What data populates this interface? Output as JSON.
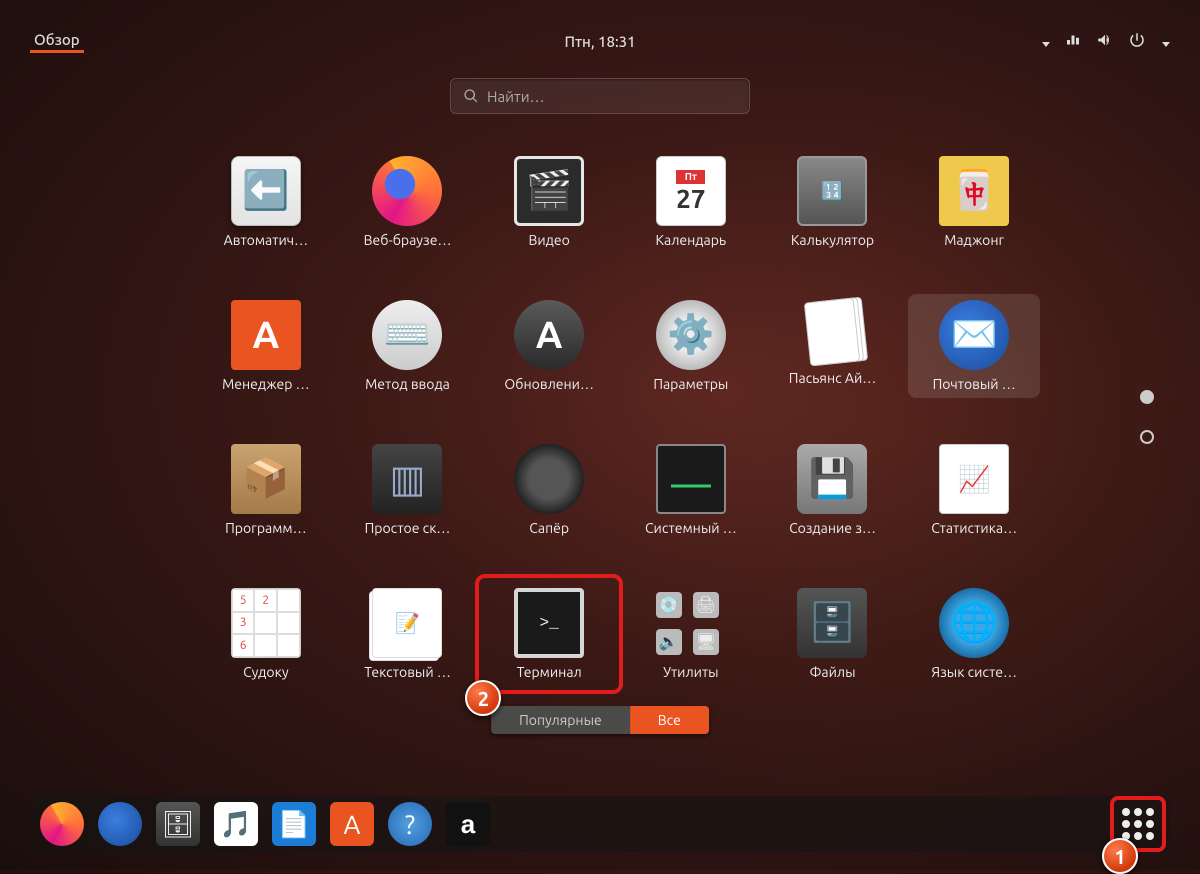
{
  "topbar": {
    "overview": "Обзор",
    "clock": "Птн, 18:31"
  },
  "search": {
    "placeholder": "Найти…"
  },
  "apps": [
    {
      "id": "auto",
      "label": "Автоматич…",
      "icon": "ic-box"
    },
    {
      "id": "firefox",
      "label": "Веб-браузе…",
      "icon": "ic-firefox"
    },
    {
      "id": "video",
      "label": "Видео",
      "icon": "ic-video"
    },
    {
      "id": "calendar",
      "label": "Календарь",
      "icon": "ic-cal"
    },
    {
      "id": "calc",
      "label": "Калькулятор",
      "icon": "ic-calc"
    },
    {
      "id": "mahjong",
      "label": "Маджонг",
      "icon": "ic-mahjong"
    },
    {
      "id": "manager",
      "label": "Менеджер …",
      "icon": "ic-bag"
    },
    {
      "id": "input",
      "label": "Метод ввода",
      "icon": "ic-input"
    },
    {
      "id": "updates",
      "label": "Обновлени…",
      "icon": "ic-update"
    },
    {
      "id": "params",
      "label": "Параметры",
      "icon": "ic-gear"
    },
    {
      "id": "solitaire",
      "label": "Пасьянс Ай…",
      "icon": "ic-cards"
    },
    {
      "id": "mail",
      "label": "Почтовый …",
      "icon": "ic-tbird",
      "selected": true
    },
    {
      "id": "software",
      "label": "Программ…",
      "icon": "ic-pkg"
    },
    {
      "id": "scan",
      "label": "Простое ск…",
      "icon": "ic-scan"
    },
    {
      "id": "mines",
      "label": "Сапёр",
      "icon": "ic-mine"
    },
    {
      "id": "sysmon",
      "label": "Системный …",
      "icon": "ic-mon"
    },
    {
      "id": "backup",
      "label": "Создание з…",
      "icon": "ic-backup"
    },
    {
      "id": "stats",
      "label": "Статистика…",
      "icon": "ic-stats"
    },
    {
      "id": "sudoku",
      "label": "Судоку",
      "icon": "ic-sudoku"
    },
    {
      "id": "text",
      "label": "Текстовый …",
      "icon": "ic-text"
    },
    {
      "id": "terminal",
      "label": "Терминал",
      "icon": "ic-term",
      "highlighted": true
    },
    {
      "id": "util",
      "label": "Утилиты",
      "icon": "ic-util"
    },
    {
      "id": "files",
      "label": "Файлы",
      "icon": "ic-files"
    },
    {
      "id": "lang",
      "label": "Язык систе…",
      "icon": "ic-lang"
    }
  ],
  "calendar_icon": {
    "weekday": "Пт",
    "day": "27"
  },
  "toggle": {
    "frequent": "Популярные",
    "all": "Все",
    "active": "all"
  },
  "dock": [
    {
      "id": "firefox",
      "name": "firefox-icon",
      "cls": "di-firefox"
    },
    {
      "id": "thunderbird",
      "name": "thunderbird-icon",
      "cls": "di-tbird"
    },
    {
      "id": "files",
      "name": "files-icon",
      "cls": "di-files",
      "glyph": "🗄"
    },
    {
      "id": "rhythmbox",
      "name": "rhythmbox-icon",
      "cls": "di-rhythm",
      "glyph": "🎵"
    },
    {
      "id": "writer",
      "name": "writer-icon",
      "cls": "di-writer",
      "glyph": "📄"
    },
    {
      "id": "software",
      "name": "software-icon",
      "cls": "di-soft",
      "glyph": "A"
    },
    {
      "id": "help",
      "name": "help-icon",
      "cls": "di-help",
      "glyph": "?"
    },
    {
      "id": "amazon",
      "name": "amazon-icon",
      "cls": "di-amazon",
      "glyph": "a"
    }
  ],
  "callouts": {
    "terminal": "2",
    "apps_button": "1"
  }
}
